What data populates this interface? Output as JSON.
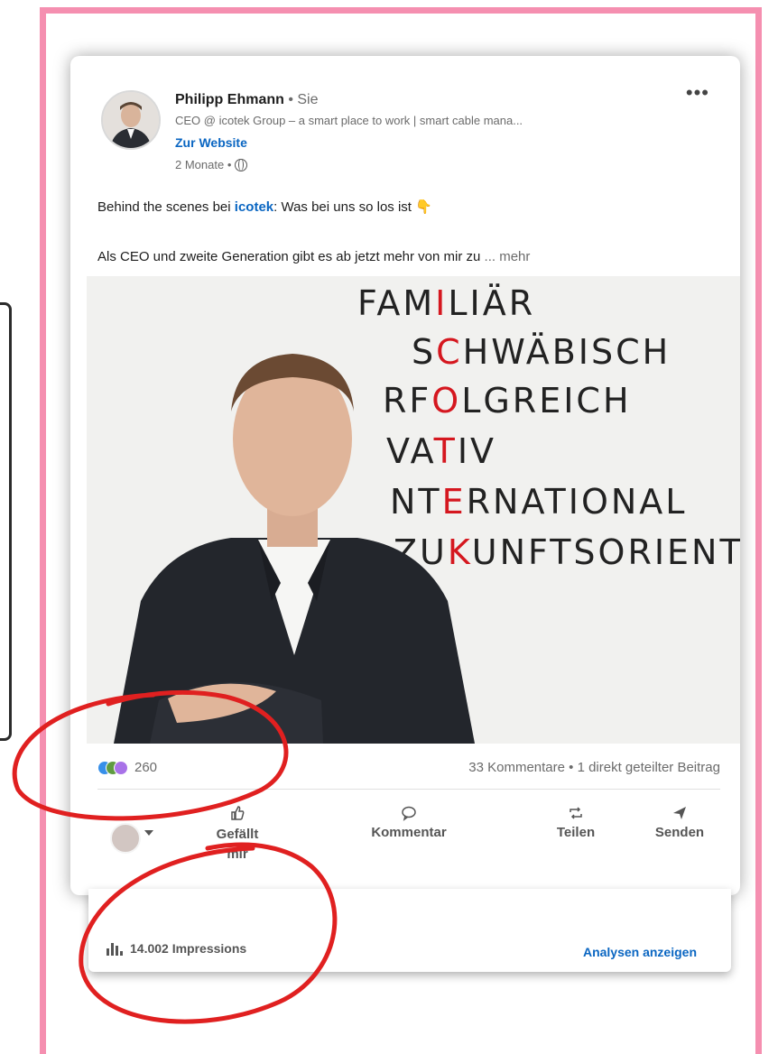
{
  "post": {
    "author_name": "Philipp Ehmann",
    "author_suffix": " • Sie",
    "headline": "CEO @ icotek Group – a smart place to work | smart cable mana...",
    "website_link": "Zur Website",
    "time": "2 Monate •",
    "more_icon": "•••",
    "text_line1_prefix": "Behind the scenes bei ",
    "text_line1_link": "icotek",
    "text_line1_suffix": ": Was bei uns so los ist ",
    "text_line1_emoji": "👇",
    "text_line2": "Als CEO und zweite Generation gibt es ab jetzt mehr von mir zu  ",
    "text_more": "... mehr"
  },
  "photo_words": {
    "line1_a": "FAM",
    "line1_red": "I",
    "line1_b": "LIÄR",
    "line2_a": "S",
    "line2_red": "C",
    "line2_b": "HWÄBISCH",
    "line3_a": "RF",
    "line3_red": "O",
    "line3_b": "LGREICH",
    "line4_a": "VA",
    "line4_red": "T",
    "line4_b": "IV",
    "line5_a": "NT",
    "line5_red": "E",
    "line5_b": "RNATIONAL",
    "line6_a": "ZU",
    "line6_red": "K",
    "line6_b": "UNFTSORIENT"
  },
  "stats": {
    "reactions_count": "260",
    "comments": "33 Kommentare • 1 direkt geteilter Beitrag"
  },
  "actions": {
    "like": "Gefällt mir",
    "comment": "Kommentar",
    "share": "Teilen",
    "send": "Senden"
  },
  "impressions": {
    "count_label": "14.002 Impressions",
    "analytics_link": "Analysen anzeigen"
  },
  "colors": {
    "frame": "#f58fb0",
    "link": "#0a66c2",
    "annotation": "#e02020"
  }
}
